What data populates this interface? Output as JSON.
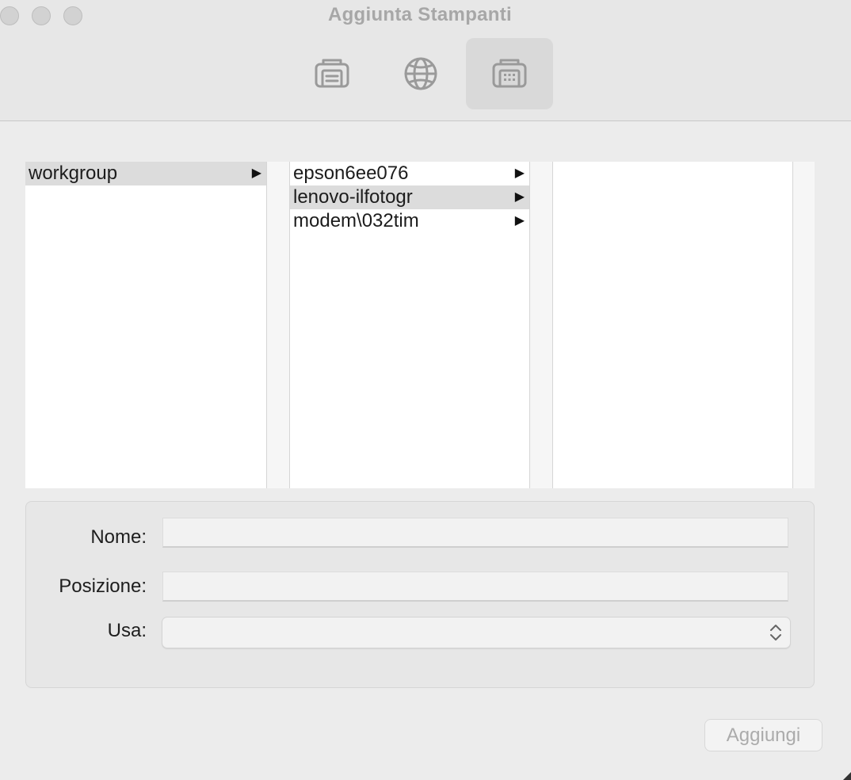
{
  "window": {
    "title": "Aggiunta Stampanti"
  },
  "toolbar": {
    "buttons": [
      {
        "icon": "default-printer-icon",
        "selected": false
      },
      {
        "icon": "ip-globe-icon",
        "selected": false
      },
      {
        "icon": "windows-printer-icon",
        "selected": true
      }
    ]
  },
  "browser": {
    "column1": [
      {
        "label": "workgroup",
        "selected": true,
        "arrow": "▶"
      }
    ],
    "column2": [
      {
        "label": "epson6ee076",
        "selected": false,
        "arrow": "▶"
      },
      {
        "label": "lenovo-ilfotogr",
        "selected": true,
        "arrow": "▶"
      },
      {
        "label": "modem\\032tim",
        "selected": false,
        "arrow": "▶"
      }
    ],
    "column3": []
  },
  "form": {
    "name_label": "Nome:",
    "name_value": "",
    "location_label": "Posizione:",
    "location_value": "",
    "use_label": "Usa:",
    "use_value": ""
  },
  "actions": {
    "add_label": "Aggiungi"
  },
  "colors": {
    "selection": "#dcdcdc",
    "toolbar_selected": "#d9d9d9",
    "disabled_text": "#ababab"
  }
}
